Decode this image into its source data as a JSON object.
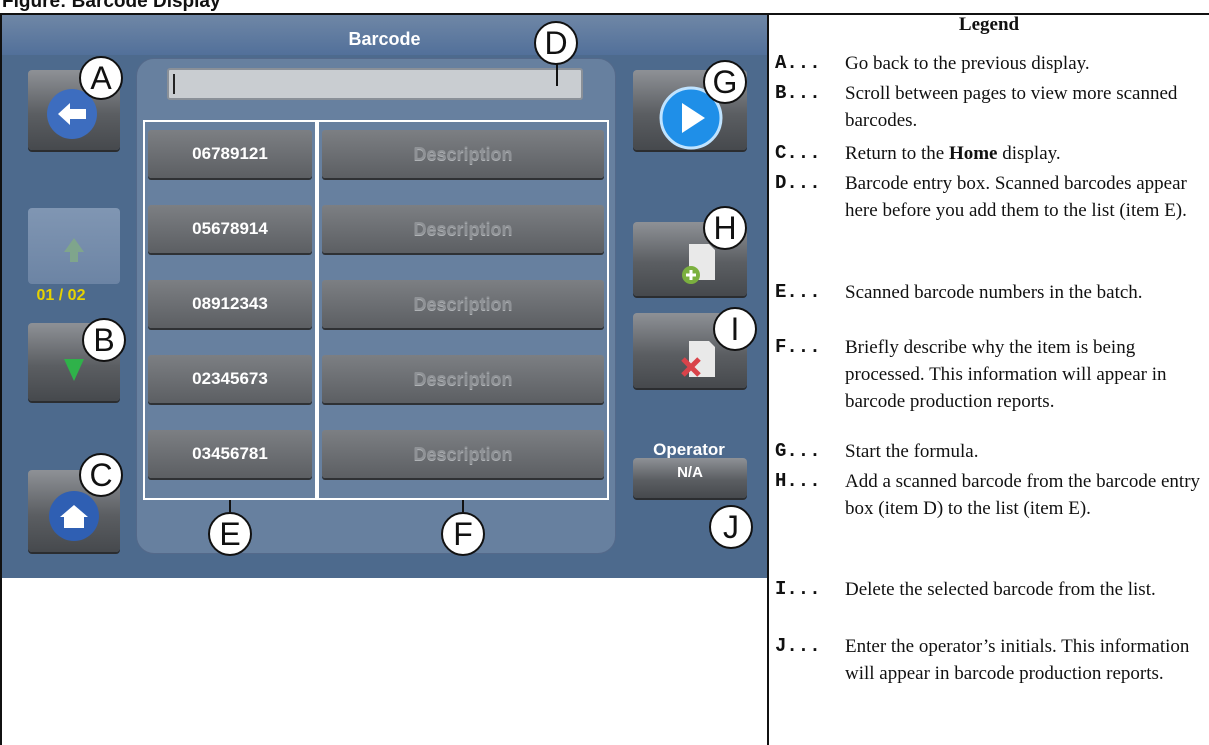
{
  "heading": "Figure: Barcode Display",
  "screen": {
    "title": "Barcode",
    "page_indicator": "01 / 02",
    "operator_label": "Operator",
    "operator_value": "N/A",
    "rows": [
      {
        "code": "06789121",
        "description": "Description"
      },
      {
        "code": "05678914",
        "description": "Description"
      },
      {
        "code": "08912343",
        "description": "Description"
      },
      {
        "code": "02345673",
        "description": "Description"
      },
      {
        "code": "03456781",
        "description": "Description"
      }
    ]
  },
  "callouts": [
    "A",
    "B",
    "C",
    "D",
    "E",
    "F",
    "G",
    "H",
    "I",
    "J"
  ],
  "legend": {
    "title": "Legend",
    "entries": [
      {
        "key": "A...",
        "text": "Go back to the previous display."
      },
      {
        "key": "B...",
        "text": "Scroll between pages to view more scanned barcodes."
      },
      {
        "key": "C...",
        "text_before": "Return to the ",
        "text_bold": "Home",
        "text_after": " display."
      },
      {
        "key": "D...",
        "text": "Barcode entry box. Scanned barcodes appear here before you add them to the list (item E)."
      },
      {
        "key": "E...",
        "text": "Scanned barcode numbers in the batch."
      },
      {
        "key": "F...",
        "text": "Briefly describe why the item is being processed. This information will appear in barcode production reports."
      },
      {
        "key": "G...",
        "text": "Start the formula."
      },
      {
        "key": "H...",
        "text": "Add a scanned barcode from the barcode entry box (item D) to the list (item E)."
      },
      {
        "key": "I...",
        "text": "Delete the selected barcode from the list."
      },
      {
        "key": "J...",
        "text": "Enter the operator’s initials. This information will appear in barcode production reports."
      }
    ]
  }
}
